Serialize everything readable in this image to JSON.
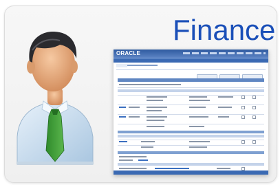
{
  "title": "Finance",
  "colors": {
    "title": "#1a4fb8",
    "shot_header": "#2e5aa0"
  },
  "screenshot": {
    "logo_text": "ORACLE"
  }
}
